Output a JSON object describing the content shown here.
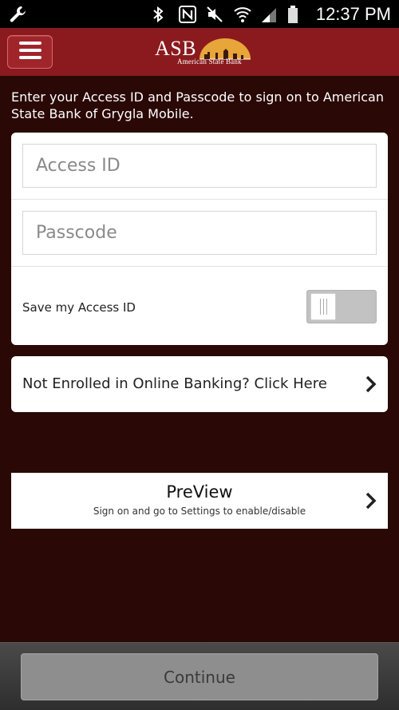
{
  "status_bar": {
    "time": "12:37 PM",
    "icons": [
      "wrench-icon",
      "bluetooth-icon",
      "nfc-icon",
      "mute-icon",
      "wifi-icon",
      "signal-icon",
      "battery-icon"
    ]
  },
  "header": {
    "menu_icon": "hamburger-menu-icon",
    "logo": {
      "abbr": "ASB",
      "name": "American State Bank"
    },
    "colors": {
      "bar": "#8b1a1e",
      "button": "#a0252a"
    }
  },
  "intro_text": "Enter your Access ID and Passcode to sign on to American State Bank of Grygla Mobile.",
  "login": {
    "access_id": {
      "placeholder": "Access ID",
      "value": ""
    },
    "passcode": {
      "placeholder": "Passcode",
      "value": ""
    },
    "save_access_id": {
      "label": "Save my Access ID",
      "on": false
    }
  },
  "enroll": {
    "label": "Not Enrolled in Online Banking? Click Here",
    "icon": "chevron-right-icon"
  },
  "preview": {
    "title": "PreView",
    "subtitle": "Sign on and go to Settings to enable/disable",
    "icon": "chevron-right-icon"
  },
  "footer": {
    "continue_label": "Continue"
  },
  "colors": {
    "background": "#2a0806",
    "accent": "#8b1a1e"
  }
}
